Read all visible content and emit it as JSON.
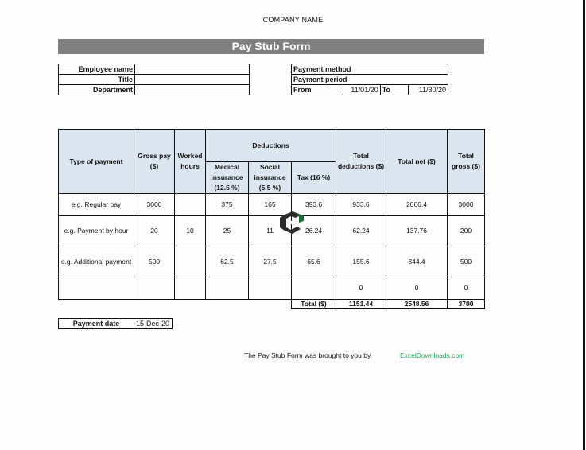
{
  "company_name": "COMPANY NAME",
  "form_title": "Pay Stub Form",
  "employee": {
    "fields": [
      {
        "label": "Employee name",
        "value": ""
      },
      {
        "label": "Title",
        "value": ""
      },
      {
        "label": "Department",
        "value": ""
      }
    ]
  },
  "payment": {
    "method_label": "Payment method",
    "method_value": "",
    "period_label": "Payment period",
    "from_label": "From",
    "from_value": "11/01/20",
    "to_label": "To",
    "to_value": "11/30/20"
  },
  "table": {
    "headers": {
      "type": "Type of payment",
      "gross_pay": "Gross pay ($)",
      "worked_hours": "Worked hours",
      "deductions": "Deductions",
      "medical": "Medical insurance (12.5 %)",
      "social": "Social insurance (5.5 %)",
      "tax": "Tax (16 %)",
      "total_deductions": "Total deductions ($)",
      "total_net": "Total net ($)",
      "total_gross": "Total gross ($)"
    },
    "rows": [
      {
        "type": "e.g. Regular pay",
        "gross_pay": "3000",
        "worked_hours": "",
        "medical": "375",
        "social": "165",
        "tax": "393.6",
        "total_deductions": "933.6",
        "total_net": "2066.4",
        "total_gross": "3000"
      },
      {
        "type": "e.g. Payment by hour",
        "gross_pay": "20",
        "worked_hours": "10",
        "medical": "25",
        "social": "11",
        "tax": "26.24",
        "total_deductions": "62.24",
        "total_net": "137.76",
        "total_gross": "200"
      },
      {
        "type": "e.g. Additional payment",
        "gross_pay": "500",
        "worked_hours": "",
        "medical": "62.5",
        "social": "27.5",
        "tax": "65.6",
        "total_deductions": "155.6",
        "total_net": "344.4",
        "total_gross": "500"
      },
      {
        "type": "",
        "gross_pay": "",
        "worked_hours": "",
        "medical": "",
        "social": "",
        "tax": "",
        "total_deductions": "0",
        "total_net": "0",
        "total_gross": "0"
      }
    ],
    "totals": {
      "label": "Total ($)",
      "total_deductions": "1151.44",
      "total_net": "2548.56",
      "total_gross": "3700"
    }
  },
  "payment_date": {
    "label": "Payment date",
    "value": "15-Dec-20"
  },
  "footer": {
    "text": "The Pay Stub Form was brought to you by",
    "link": "ExcelDownloads.com",
    "link_color": "#22a05a"
  },
  "colors": {
    "title_bar": "#808080",
    "header_fill": "#dce6f1",
    "logo_dark": "#2b2b2b",
    "logo_green": "#1e6b3a"
  },
  "watermark_icon": "exceldownloads-logo-icon"
}
